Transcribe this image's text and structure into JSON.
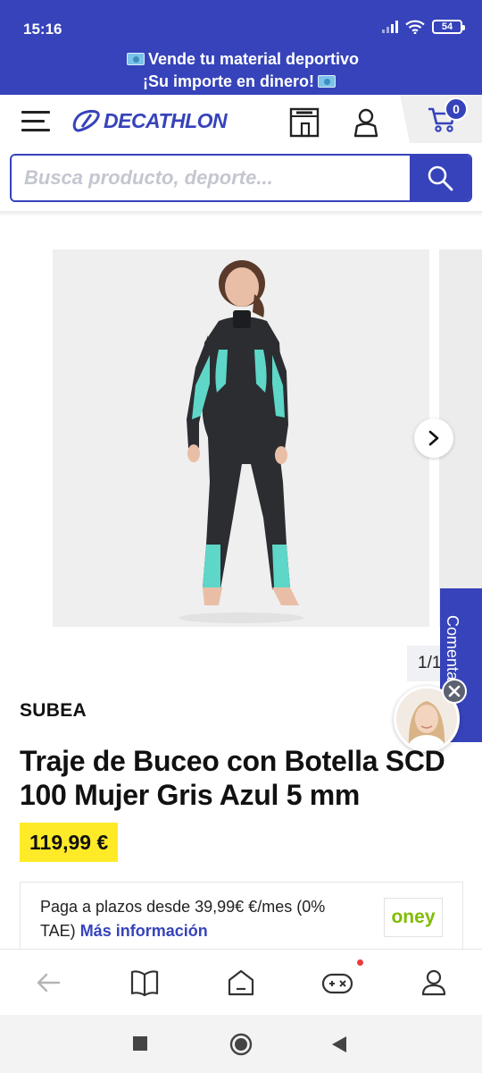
{
  "status_bar": {
    "time": "15:16",
    "battery": "54"
  },
  "promo": {
    "line1": "Vende tu material deportivo",
    "line2": "¡Su importe en dinero!"
  },
  "header": {
    "logo_text": "DECATHLON",
    "cart_count": "0"
  },
  "search": {
    "placeholder": "Busca producto, deporte..."
  },
  "gallery": {
    "counter": "1/1"
  },
  "feedback_tab": {
    "label": "Comentarios"
  },
  "product": {
    "brand": "SUBEA",
    "title": "Traje de Buceo con Botella SCD 100 Mujer Gris Azul 5 mm",
    "price": "119,99 €"
  },
  "financing": {
    "text": "Paga a plazos desde 39,99€ €/mes (0% TAE)",
    "link": "Más información",
    "provider": "oney"
  },
  "colors": {
    "brand_blue": "#3643ba",
    "price_yellow": "#ffea28",
    "oney_green": "#80bc00"
  },
  "bottom_nav": [
    "back-arrow-icon",
    "book-icon",
    "home-icon",
    "gamepad-icon",
    "profile-icon"
  ]
}
